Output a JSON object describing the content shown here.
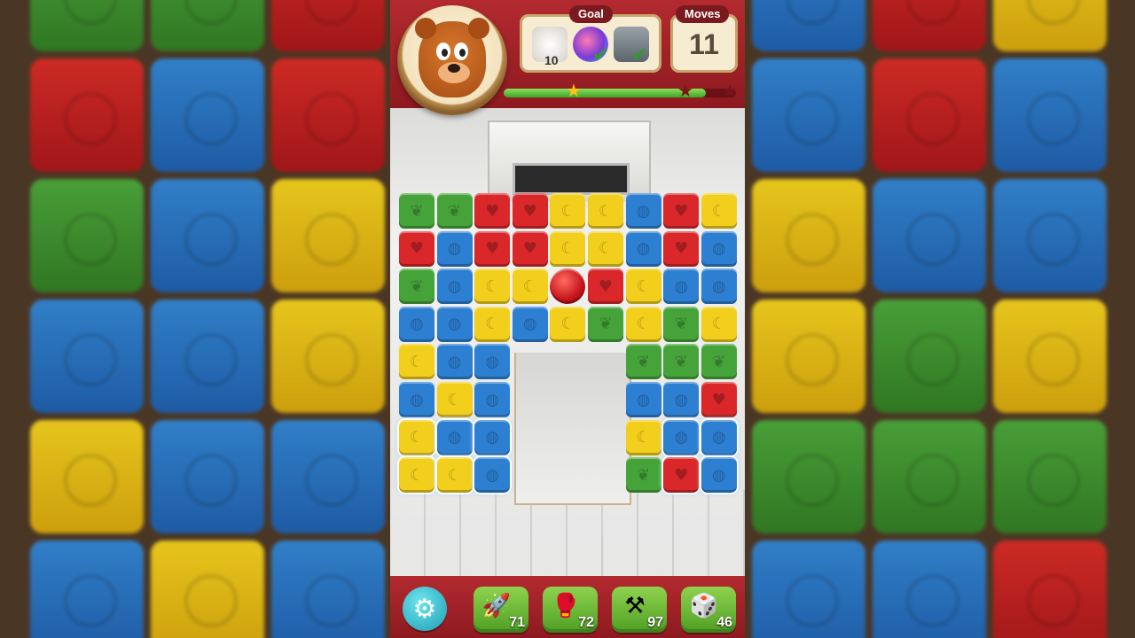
{
  "hud": {
    "goal_label": "Goal",
    "goal_count": "10",
    "goal_check_1": "✔",
    "goal_check_2": "✔",
    "moves_label": "Moves",
    "moves_value": "11",
    "progress": 0.87,
    "star_1": "★",
    "star_2": "★",
    "star_3": "★"
  },
  "board": {
    "colors": {
      "r": "#d9272a",
      "b": "#2d7fd2",
      "g": "#45a33a",
      "y": "#f2cf1c"
    },
    "symbols": {
      "r": "♥",
      "b": "◍",
      "g": "❦",
      "y": "☾"
    },
    "rows": [
      [
        "g",
        "g",
        "r",
        "r",
        "y",
        "y",
        "b",
        "r",
        "y"
      ],
      [
        "r",
        "b",
        "r",
        "r",
        "y",
        "y",
        "b",
        "r",
        "b"
      ],
      [
        "g",
        "b",
        "y",
        "y",
        "X",
        "r",
        "y",
        "b",
        "b"
      ],
      [
        "b",
        "b",
        "y",
        "b",
        "y",
        "g",
        "y",
        "g",
        "y"
      ],
      [
        "y",
        "b",
        "b",
        "",
        "",
        "",
        "g",
        "g",
        "g"
      ],
      [
        "b",
        "y",
        "b",
        "",
        "",
        "",
        "b",
        "b",
        "r"
      ],
      [
        "y",
        "b",
        "b",
        "",
        "",
        "",
        "y",
        "b",
        "b"
      ],
      [
        "y",
        "y",
        "b",
        "",
        "",
        "",
        "g",
        "r",
        "b"
      ]
    ],
    "glass": [
      "6-0",
      "6-1",
      "6-2",
      "7-0",
      "7-1",
      "7-2",
      "6-7",
      "6-8",
      "7-7",
      "7-8"
    ]
  },
  "toolbar": {
    "boosters": [
      {
        "name": "rocket-booster",
        "icon": "🚀",
        "count": "71"
      },
      {
        "name": "boxing-glove-booster",
        "icon": "🥊",
        "count": "72"
      },
      {
        "name": "hammer-booster",
        "icon": "⚒",
        "count": "97"
      },
      {
        "name": "dice-booster",
        "icon": "🎲",
        "count": "46"
      }
    ]
  }
}
